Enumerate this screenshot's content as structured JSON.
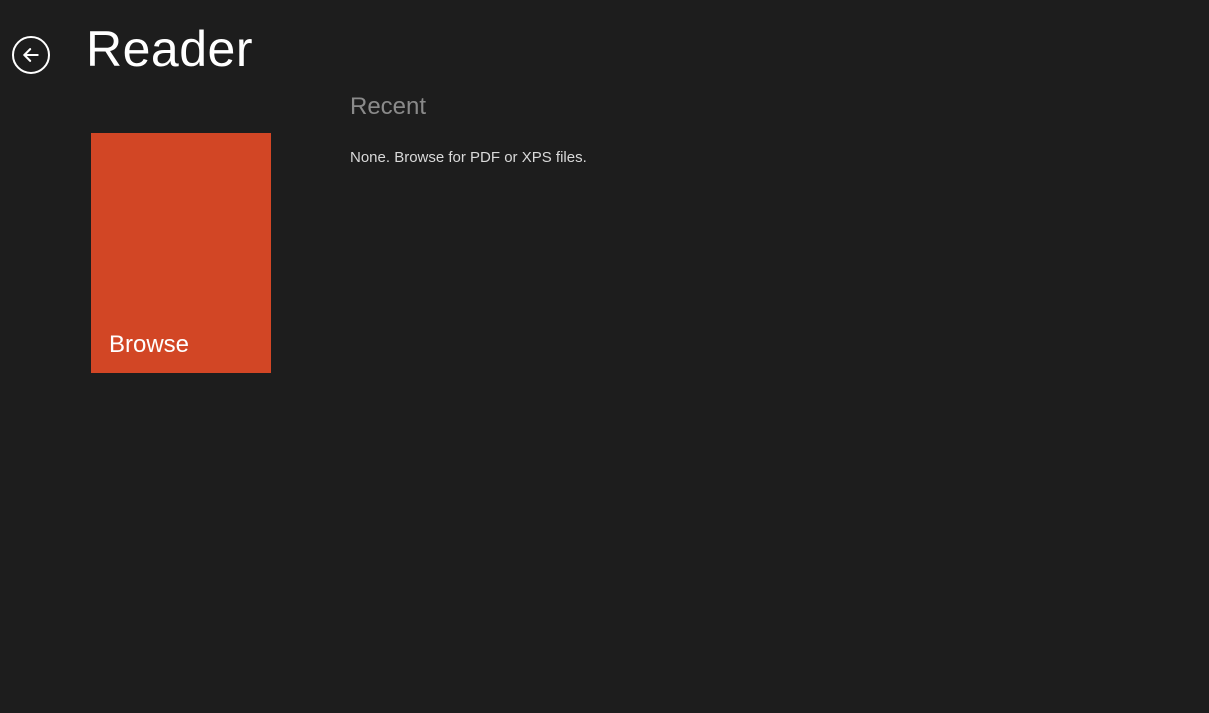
{
  "header": {
    "app_title": "Reader"
  },
  "browse": {
    "label": "Browse",
    "tile_color": "#d24625"
  },
  "recent": {
    "heading": "Recent",
    "empty_message": "None. Browse for PDF or XPS files."
  }
}
